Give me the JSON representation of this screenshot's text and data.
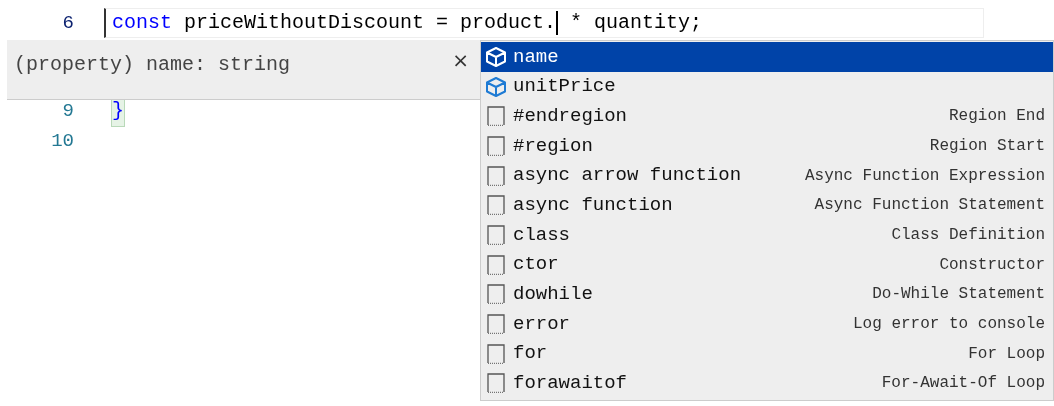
{
  "editor": {
    "lines": [
      {
        "number": "6",
        "current": true,
        "tokens": [
          {
            "kind": "keyword",
            "text": "const"
          },
          {
            "kind": "plain",
            "text": " priceWithoutDiscount = product."
          },
          {
            "kind": "cursor"
          },
          {
            "kind": "plain",
            "text": " * quantity;"
          }
        ]
      },
      {
        "number": "9",
        "current": false,
        "tokens": [
          {
            "kind": "bracket",
            "text": "}"
          }
        ]
      },
      {
        "number": "10",
        "current": false
      }
    ]
  },
  "hover_tooltip": {
    "text": "(property) name: string",
    "close": "×"
  },
  "suggestions": [
    {
      "kind": "property",
      "label": "name",
      "selected": true
    },
    {
      "kind": "property",
      "label": "unitPrice",
      "selected": false
    },
    {
      "kind": "snippet",
      "label": "#endregion",
      "detail": "Region End",
      "selected": false
    },
    {
      "kind": "snippet",
      "label": "#region",
      "detail": "Region Start",
      "selected": false
    },
    {
      "kind": "snippet",
      "label": "async arrow function",
      "detail": "Async Function Expression",
      "selected": false
    },
    {
      "kind": "snippet",
      "label": "async function",
      "detail": "Async Function Statement",
      "selected": false
    },
    {
      "kind": "snippet",
      "label": "class",
      "detail": "Class Definition",
      "selected": false
    },
    {
      "kind": "snippet",
      "label": "ctor",
      "detail": "Constructor",
      "selected": false
    },
    {
      "kind": "snippet",
      "label": "dowhile",
      "detail": "Do-While Statement",
      "selected": false
    },
    {
      "kind": "snippet",
      "label": "error",
      "detail": "Log error to console",
      "selected": false
    },
    {
      "kind": "snippet",
      "label": "for",
      "detail": "For Loop",
      "selected": false
    },
    {
      "kind": "snippet",
      "label": "forawaitof",
      "detail": "For-Await-Of Loop",
      "selected": false
    }
  ]
}
